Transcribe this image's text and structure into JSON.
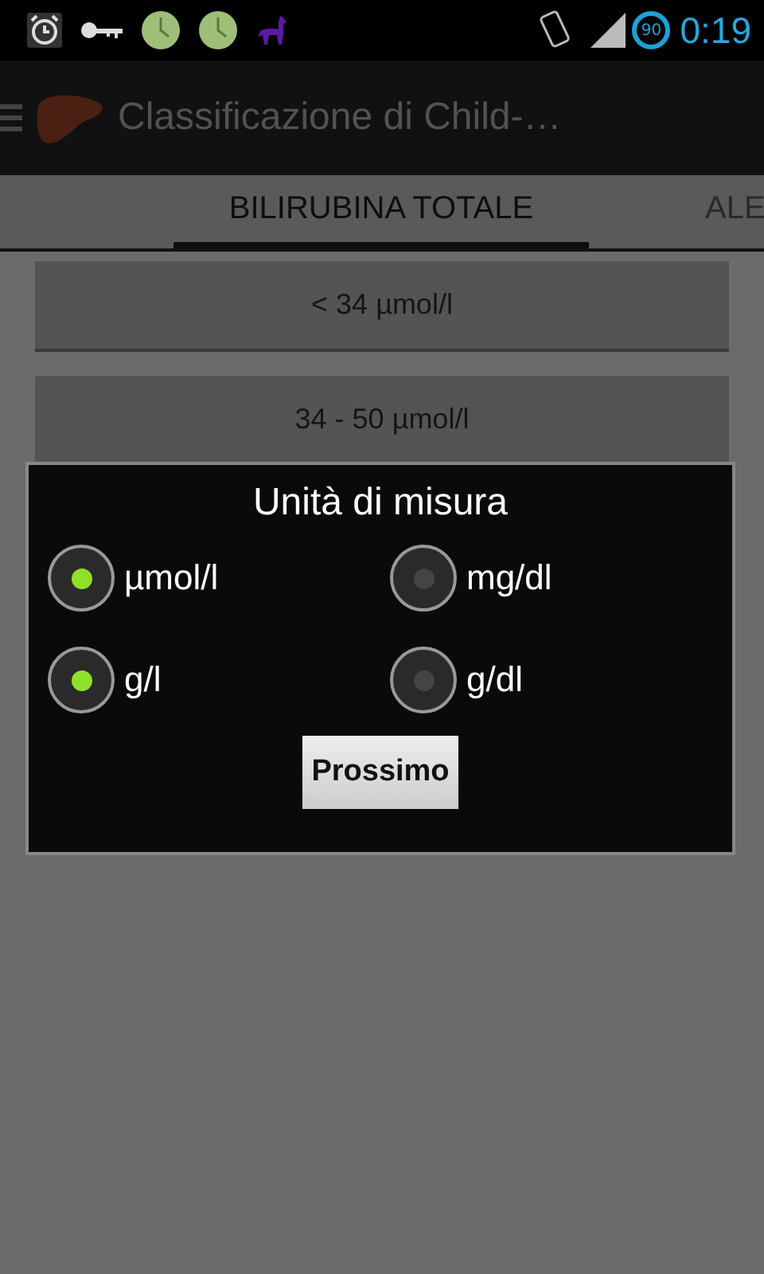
{
  "status_bar": {
    "battery": "90",
    "time": "0:19"
  },
  "action_bar": {
    "title": "Classificazione di Child-…"
  },
  "tabs": [
    {
      "label": "BILIRUBINA TOTALE",
      "selected": true
    },
    {
      "label": "ALE",
      "selected": false
    }
  ],
  "options": [
    "< 34 µmol/l",
    "34 - 50 µmol/l"
  ],
  "dialog": {
    "title": "Unità di misura",
    "radios": [
      {
        "label": "µmol/l",
        "selected": true
      },
      {
        "label": "mg/dl",
        "selected": false
      },
      {
        "label": "g/l",
        "selected": true
      },
      {
        "label": "g/dl",
        "selected": false
      }
    ],
    "button": "Prossimo"
  }
}
